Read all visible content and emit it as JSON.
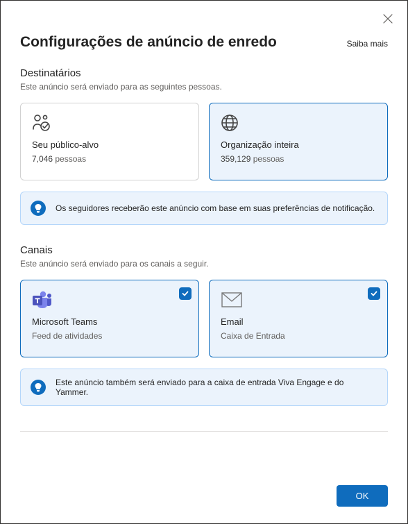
{
  "header": {
    "title": "Configurações de anúncio de enredo",
    "learn_more": "Saiba mais"
  },
  "recipients": {
    "title": "Destinatários",
    "description": "Este anúncio será enviado para as seguintes pessoas.",
    "options": [
      {
        "label": "Seu público-alvo",
        "count": "7,046",
        "unit": "pessoas",
        "selected": false,
        "icon": "people-check-icon"
      },
      {
        "label": "Organização inteira",
        "count": "359,129",
        "unit": "pessoas",
        "selected": true,
        "icon": "globe-icon"
      }
    ],
    "info": "Os seguidores receberão este anúncio com base em suas preferências de notificação."
  },
  "channels": {
    "title": "Canais",
    "description": "Este anúncio será enviado para os canais a seguir.",
    "options": [
      {
        "label": "Microsoft Teams",
        "sub": "Feed de atividades",
        "checked": true,
        "icon": "teams-icon"
      },
      {
        "label": "Email",
        "sub": "Caixa de Entrada",
        "checked": true,
        "icon": "mail-icon"
      }
    ],
    "info": "Este anúncio também será enviado para a caixa de entrada Viva Engage e do Yammer."
  },
  "footer": {
    "ok": "OK"
  }
}
